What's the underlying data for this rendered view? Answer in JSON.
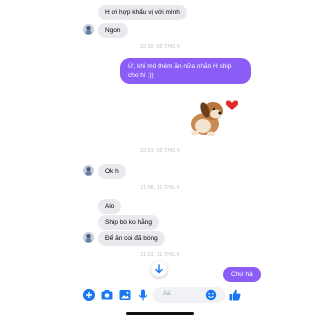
{
  "colors": {
    "accent": "#8b5cf6",
    "incoming_bubble": "#e9eaed",
    "toolbar_blue": "#1877f2",
    "timestamp": "#bcc0c4"
  },
  "messages": {
    "m1": "H ơi hợp khẩu vị với mình",
    "m2": "Ngon",
    "m3": "Ừ, khi mô thèm ăn nữa nhắn H ship cho hí :))",
    "m4": "Ok h",
    "m5": "Alo",
    "m6": "Ship bò ko hằng",
    "m7": "Để ăn coi đã bóng",
    "m8": "Chứ hà"
  },
  "timestamps": {
    "t1": "15:35, 05 THG 6",
    "t2": "15:53, 05 THG 6",
    "t3": "21:08, 11 THG 6",
    "t4": "21:23, 11 THG 6"
  },
  "sticker": {
    "name": "dog-with-heart-sticker"
  },
  "composer": {
    "placeholder": "Aa",
    "icons": [
      "plus-icon",
      "camera-icon",
      "image-icon",
      "microphone-icon",
      "emoji-icon",
      "like-icon"
    ]
  },
  "scroll_down": {
    "icon": "arrow-down-icon"
  }
}
